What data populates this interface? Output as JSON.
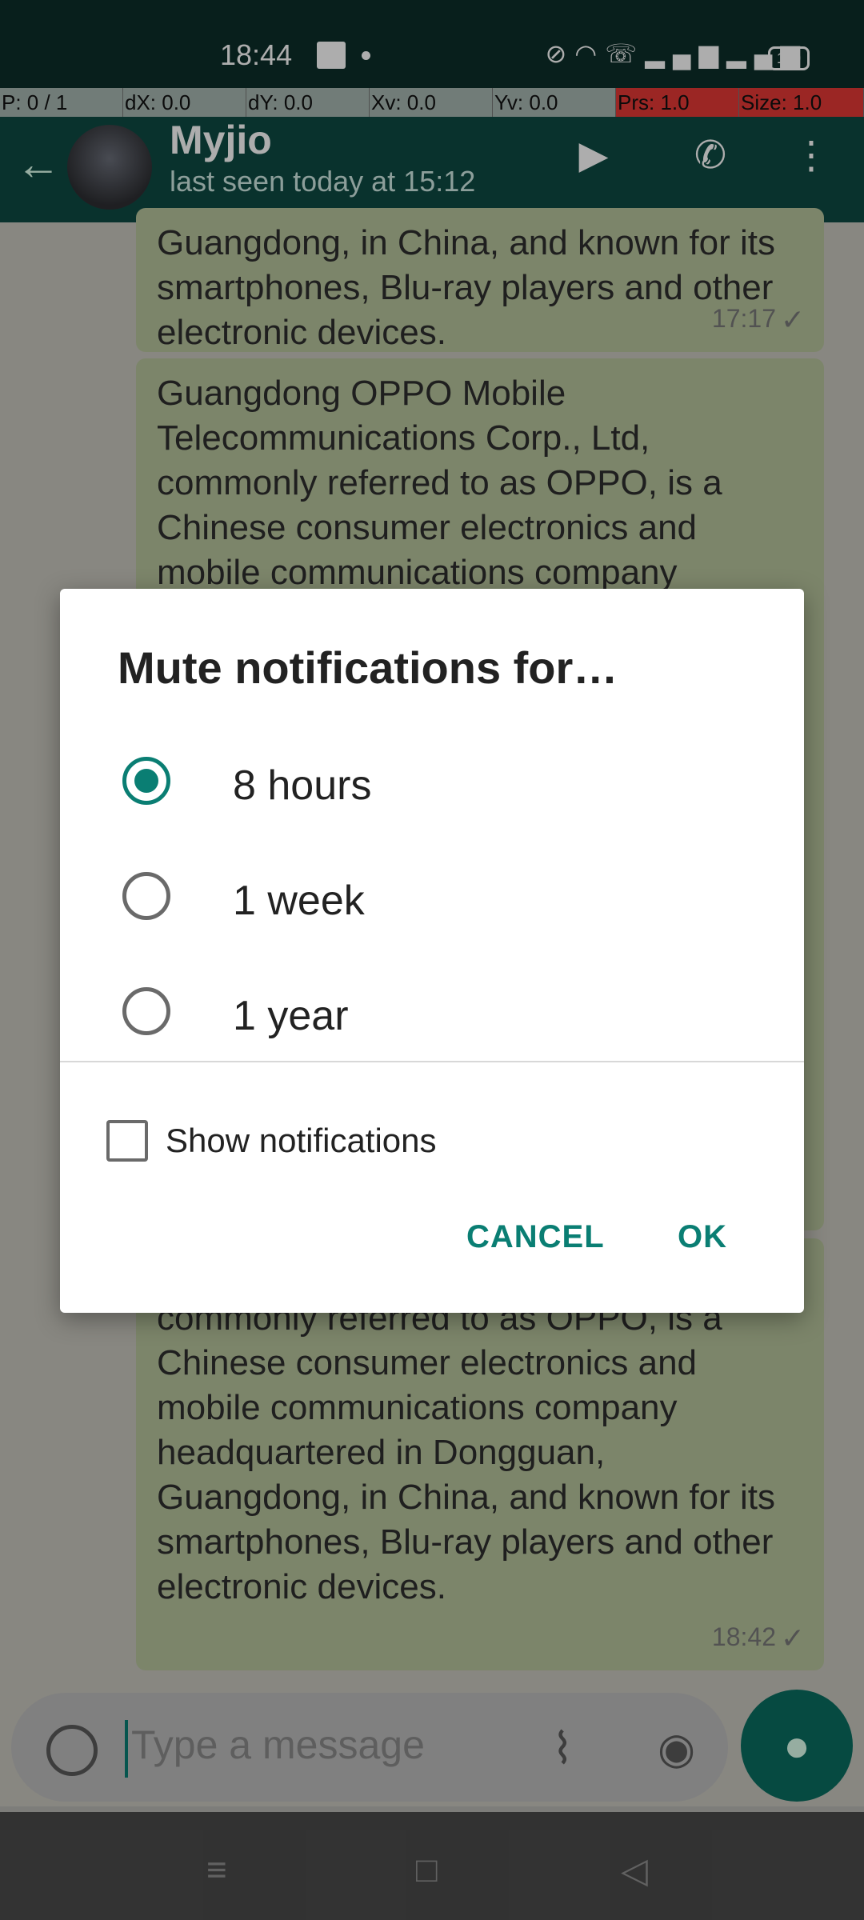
{
  "status_bar": {
    "time": "18:44",
    "battery": "100"
  },
  "debug": {
    "pointer": "P: 0 / 1",
    "dx": "dX: 0.0",
    "dy": "dY: 0.0",
    "xv": "Xv: 0.0",
    "yv": "Yv: 0.0",
    "prs": "Prs: 1.0",
    "size": "Size: 1.0"
  },
  "header": {
    "name": "Myjio",
    "last_seen": "last seen today at 15:12"
  },
  "chat": {
    "messages": [
      {
        "text": "Guangdong, in China, and known for its smartphones, Blu-ray players and other electronic devices.",
        "time": "17:17"
      },
      {
        "text": "Guangdong OPPO Mobile Telecommunications Corp., Ltd, commonly referred to as OPPO, is a Chinese consumer electronics and mobile communications company headquartered in Dongguan, Guangdong, in China, and known for its smartphones, Blu-ray players and other electronic devices.",
        "time": ""
      },
      {
        "text": "Telecommunications Corp., Ltd, commonly referred to as OPPO, is a Chinese consumer electronics and mobile communications company headquartered in Dongguan, Guangdong, in China, and known for its smartphones, Blu-ray players and other electronic devices.",
        "time": "18:42"
      }
    ]
  },
  "input": {
    "placeholder": "Type a message"
  },
  "dialog": {
    "title": "Mute notifications for…",
    "options": [
      {
        "label": "8 hours",
        "selected": true
      },
      {
        "label": "1 week",
        "selected": false
      },
      {
        "label": "1 year",
        "selected": false
      }
    ],
    "show_notifications_label": "Show notifications",
    "show_notifications_checked": false,
    "cancel_label": "CANCEL",
    "ok_label": "OK"
  },
  "colors": {
    "accent": "#0a7e73",
    "header": "#0e4a43",
    "bubble": "#b7c59d"
  }
}
